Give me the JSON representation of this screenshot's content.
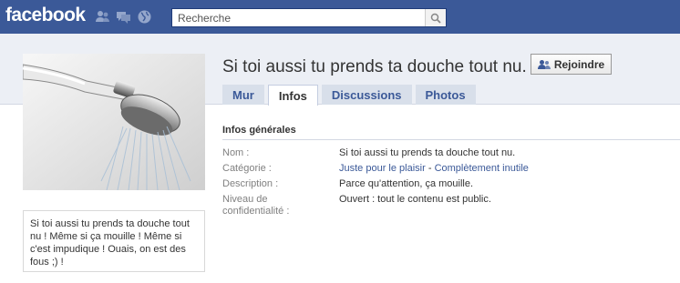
{
  "header": {
    "logo": "facebook",
    "search_placeholder": "Recherche"
  },
  "page": {
    "title": "Si toi aussi tu prends ta douche tout nu.",
    "join_label": "Rejoindre",
    "tabs": [
      "Mur",
      "Infos",
      "Discussions",
      "Photos"
    ],
    "active_tab": "Infos",
    "description_box": "Si toi aussi tu prends ta douche tout nu ! Même si ça mouille ! Même si c'est impudique ! Ouais, on est des fous ;) !"
  },
  "info": {
    "section_title": "Infos générales",
    "rows": [
      {
        "label": "Nom :",
        "value": "Si toi aussi tu prends ta douche tout nu."
      },
      {
        "label": "Catégorie :",
        "link1": "Juste pour le plaisir",
        "separator": " - ",
        "link2": "Complètement inutile"
      },
      {
        "label": "Description :",
        "value": "Parce qu'attention, ça mouille."
      },
      {
        "label": "Niveau de confidentialité :",
        "value": "Ouvert : tout le contenu est public."
      }
    ]
  },
  "colors": {
    "brand_blue": "#3b5998",
    "tab_bg": "#d8dfea",
    "band_bg": "#eceff5"
  },
  "icons": [
    "friends-icon",
    "messages-icon",
    "globe-icon",
    "search-icon",
    "join-group-icon"
  ]
}
